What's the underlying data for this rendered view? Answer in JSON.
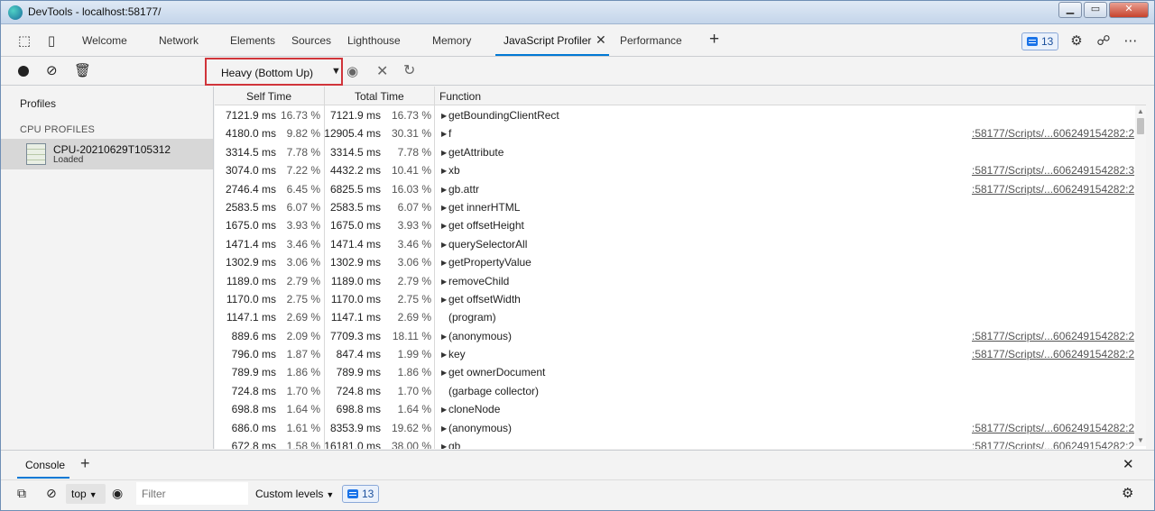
{
  "window": {
    "title": "DevTools - localhost:58177/"
  },
  "main_tabs": [
    {
      "label": "Welcome"
    },
    {
      "label": "Network"
    },
    {
      "label": "Elements"
    },
    {
      "label": "Sources"
    },
    {
      "label": "Lighthouse"
    },
    {
      "label": "Memory"
    },
    {
      "label": "JavaScript Profiler",
      "active": true
    },
    {
      "label": "Performance"
    }
  ],
  "issues_count": "13",
  "profiler_toolbar": {
    "view_select": "Heavy (Bottom Up)"
  },
  "sidebar": {
    "title": "Profiles",
    "section": "CPU PROFILES",
    "item_name": "CPU-20210629T105312",
    "item_status": "Loaded"
  },
  "grid": {
    "headers": {
      "self": "Self Time",
      "total": "Total Time",
      "function": "Function"
    },
    "rows": [
      {
        "self_ms": "7121.9 ms",
        "self_pct": "16.73 %",
        "total_ms": "7121.9 ms",
        "total_pct": "16.73 %",
        "fn": "getBoundingClientRect",
        "arrow": true,
        "src": ""
      },
      {
        "self_ms": "4180.0 ms",
        "self_pct": "9.82 %",
        "total_ms": "12905.4 ms",
        "total_pct": "30.31 %",
        "fn": "f",
        "arrow": true,
        "src": ":58177/Scripts/...606249154282:2"
      },
      {
        "self_ms": "3314.5 ms",
        "self_pct": "7.78 %",
        "total_ms": "3314.5 ms",
        "total_pct": "7.78 %",
        "fn": "getAttribute",
        "arrow": true,
        "src": ""
      },
      {
        "self_ms": "3074.0 ms",
        "self_pct": "7.22 %",
        "total_ms": "4432.2 ms",
        "total_pct": "10.41 %",
        "fn": "xb",
        "arrow": true,
        "src": ":58177/Scripts/...606249154282:3"
      },
      {
        "self_ms": "2746.4 ms",
        "self_pct": "6.45 %",
        "total_ms": "6825.5 ms",
        "total_pct": "16.03 %",
        "fn": "gb.attr",
        "arrow": true,
        "src": ":58177/Scripts/...606249154282:2"
      },
      {
        "self_ms": "2583.5 ms",
        "self_pct": "6.07 %",
        "total_ms": "2583.5 ms",
        "total_pct": "6.07 %",
        "fn": "get innerHTML",
        "arrow": true,
        "src": ""
      },
      {
        "self_ms": "1675.0 ms",
        "self_pct": "3.93 %",
        "total_ms": "1675.0 ms",
        "total_pct": "3.93 %",
        "fn": "get offsetHeight",
        "arrow": true,
        "src": ""
      },
      {
        "self_ms": "1471.4 ms",
        "self_pct": "3.46 %",
        "total_ms": "1471.4 ms",
        "total_pct": "3.46 %",
        "fn": "querySelectorAll",
        "arrow": true,
        "src": ""
      },
      {
        "self_ms": "1302.9 ms",
        "self_pct": "3.06 %",
        "total_ms": "1302.9 ms",
        "total_pct": "3.06 %",
        "fn": "getPropertyValue",
        "arrow": true,
        "src": ""
      },
      {
        "self_ms": "1189.0 ms",
        "self_pct": "2.79 %",
        "total_ms": "1189.0 ms",
        "total_pct": "2.79 %",
        "fn": "removeChild",
        "arrow": true,
        "src": ""
      },
      {
        "self_ms": "1170.0 ms",
        "self_pct": "2.75 %",
        "total_ms": "1170.0 ms",
        "total_pct": "2.75 %",
        "fn": "get offsetWidth",
        "arrow": true,
        "src": ""
      },
      {
        "self_ms": "1147.1 ms",
        "self_pct": "2.69 %",
        "total_ms": "1147.1 ms",
        "total_pct": "2.69 %",
        "fn": "(program)",
        "arrow": false,
        "src": ""
      },
      {
        "self_ms": "889.6 ms",
        "self_pct": "2.09 %",
        "total_ms": "7709.3 ms",
        "total_pct": "18.11 %",
        "fn": "(anonymous)",
        "arrow": true,
        "src": ":58177/Scripts/...606249154282:2"
      },
      {
        "self_ms": "796.0 ms",
        "self_pct": "1.87 %",
        "total_ms": "847.4 ms",
        "total_pct": "1.99 %",
        "fn": "key",
        "arrow": true,
        "src": ":58177/Scripts/...606249154282:2"
      },
      {
        "self_ms": "789.9 ms",
        "self_pct": "1.86 %",
        "total_ms": "789.9 ms",
        "total_pct": "1.86 %",
        "fn": "get ownerDocument",
        "arrow": true,
        "src": ""
      },
      {
        "self_ms": "724.8 ms",
        "self_pct": "1.70 %",
        "total_ms": "724.8 ms",
        "total_pct": "1.70 %",
        "fn": "(garbage collector)",
        "arrow": false,
        "src": ""
      },
      {
        "self_ms": "698.8 ms",
        "self_pct": "1.64 %",
        "total_ms": "698.8 ms",
        "total_pct": "1.64 %",
        "fn": "cloneNode",
        "arrow": true,
        "src": ""
      },
      {
        "self_ms": "686.0 ms",
        "self_pct": "1.61 %",
        "total_ms": "8353.9 ms",
        "total_pct": "19.62 %",
        "fn": "(anonymous)",
        "arrow": true,
        "src": ":58177/Scripts/...606249154282:2"
      },
      {
        "self_ms": "672.8 ms",
        "self_pct": "1.58 %",
        "total_ms": "16181.0 ms",
        "total_pct": "38.00 %",
        "fn": "gb",
        "arrow": true,
        "src": ":58177/Scripts/...606249154282:2"
      }
    ]
  },
  "drawer": {
    "tab": "Console",
    "context": "top",
    "filter_placeholder": "Filter",
    "levels": "Custom levels",
    "count": "13"
  },
  "icons": {
    "glyphs": {
      "inspect": "⬚",
      "device": "▯",
      "close": "✕",
      "plus": "+",
      "gear": "⚙",
      "more": "⋯",
      "record": "●",
      "clear": "⊘",
      "trash": "🗑",
      "eye": "👁",
      "reload": "↻"
    }
  }
}
